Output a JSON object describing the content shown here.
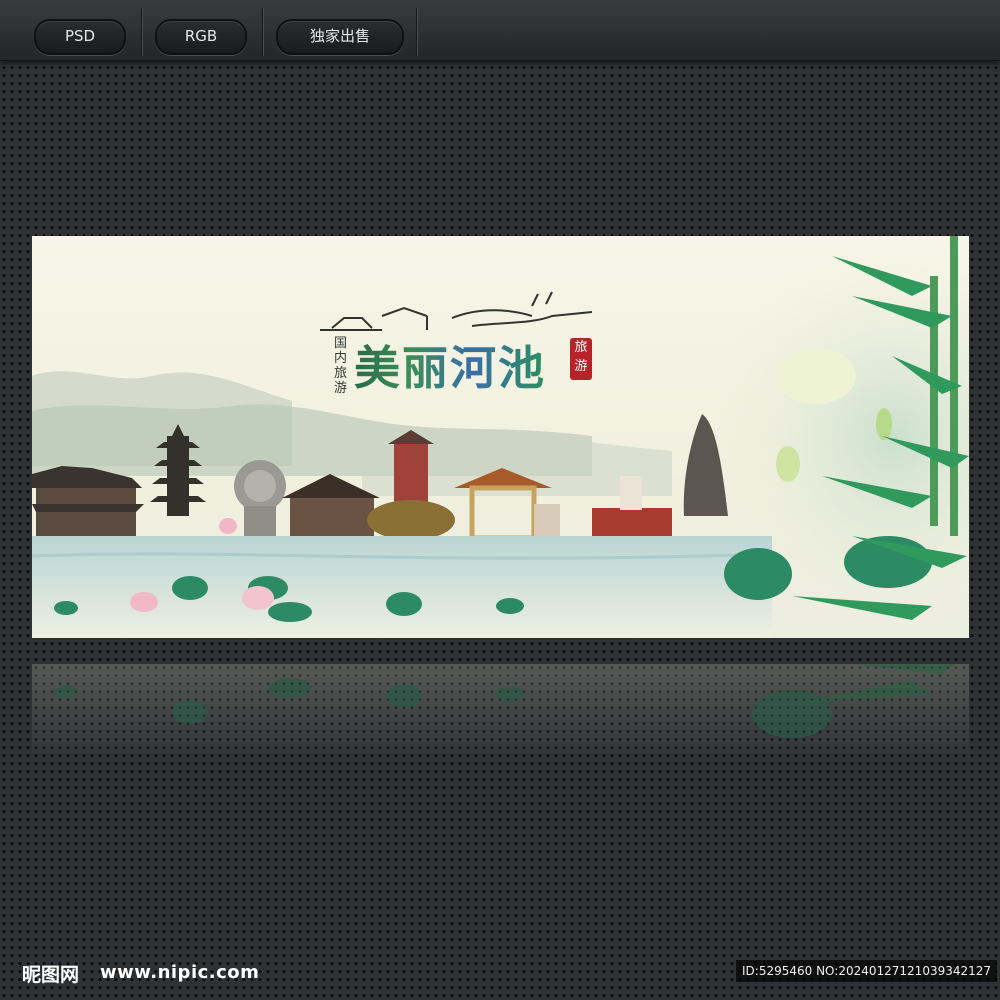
{
  "toolbar": {
    "format_label": "PSD",
    "color_mode_label": "RGB",
    "exclusive_label": "独家出售"
  },
  "poster": {
    "title": "美丽河池",
    "subtitle": "国内旅游",
    "seal_text": "旅游"
  },
  "watermark": {
    "logo_text": "昵图网",
    "url": "www.nipic.com",
    "id_text": "ID:5295460 NO:20240127121039342127"
  },
  "colors": {
    "background": "#2e3033",
    "accent_green": "#3a8f5a",
    "accent_blue": "#3a6ea8",
    "seal_red": "#b8232a"
  }
}
